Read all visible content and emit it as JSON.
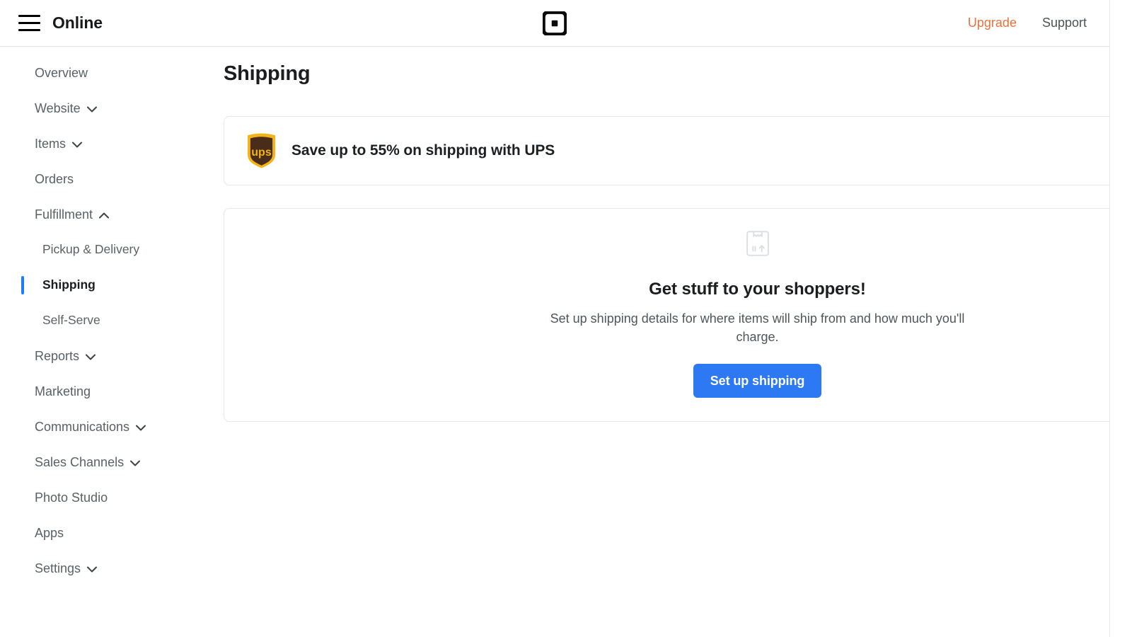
{
  "header": {
    "menu_icon": "hamburger-menu-icon",
    "brand_title": "Online",
    "logo_icon": "square-logo-icon",
    "upgrade_label": "Upgrade",
    "support_label": "Support",
    "accent_color": "#e8713c",
    "support_color": "#4c5257"
  },
  "sidebar": {
    "items": [
      {
        "label": "Overview",
        "level": "top",
        "chevron": "none",
        "active": false
      },
      {
        "label": "Website",
        "level": "top",
        "chevron": "down",
        "active": false
      },
      {
        "label": "Items",
        "level": "top",
        "chevron": "down",
        "active": false
      },
      {
        "label": "Orders",
        "level": "top",
        "chevron": "none",
        "active": false
      },
      {
        "label": "Fulfillment",
        "level": "top",
        "chevron": "up",
        "active": false
      },
      {
        "label": "Pickup & Delivery",
        "level": "sub",
        "chevron": "none",
        "active": false
      },
      {
        "label": "Shipping",
        "level": "sub",
        "chevron": "none",
        "active": true
      },
      {
        "label": "Self-Serve",
        "level": "sub",
        "chevron": "none",
        "active": false
      },
      {
        "label": "Reports",
        "level": "top",
        "chevron": "down",
        "active": false
      },
      {
        "label": "Marketing",
        "level": "top",
        "chevron": "none",
        "active": false
      },
      {
        "label": "Communications",
        "level": "top",
        "chevron": "down",
        "active": false
      },
      {
        "label": "Sales Channels",
        "level": "top",
        "chevron": "down",
        "active": false
      },
      {
        "label": "Photo Studio",
        "level": "top",
        "chevron": "none",
        "active": false
      },
      {
        "label": "Apps",
        "level": "top",
        "chevron": "none",
        "active": false
      },
      {
        "label": "Settings",
        "level": "top",
        "chevron": "down",
        "active": false
      }
    ],
    "active_indicator_color": "#1f7df5"
  },
  "main": {
    "page_title": "Shipping",
    "ups_banner": {
      "logo_icon": "ups-shield-icon",
      "text": "Save up to 55% on shipping with UPS",
      "logo_gold": "#f2b418",
      "logo_brown": "#4a2c1a"
    },
    "empty_state": {
      "icon": "package-box-icon",
      "title": "Get stuff to your shoppers!",
      "description": "Set up shipping details for where items will ship from and how much you'll charge.",
      "button_label": "Set up shipping",
      "button_color": "#2d79f3"
    }
  }
}
